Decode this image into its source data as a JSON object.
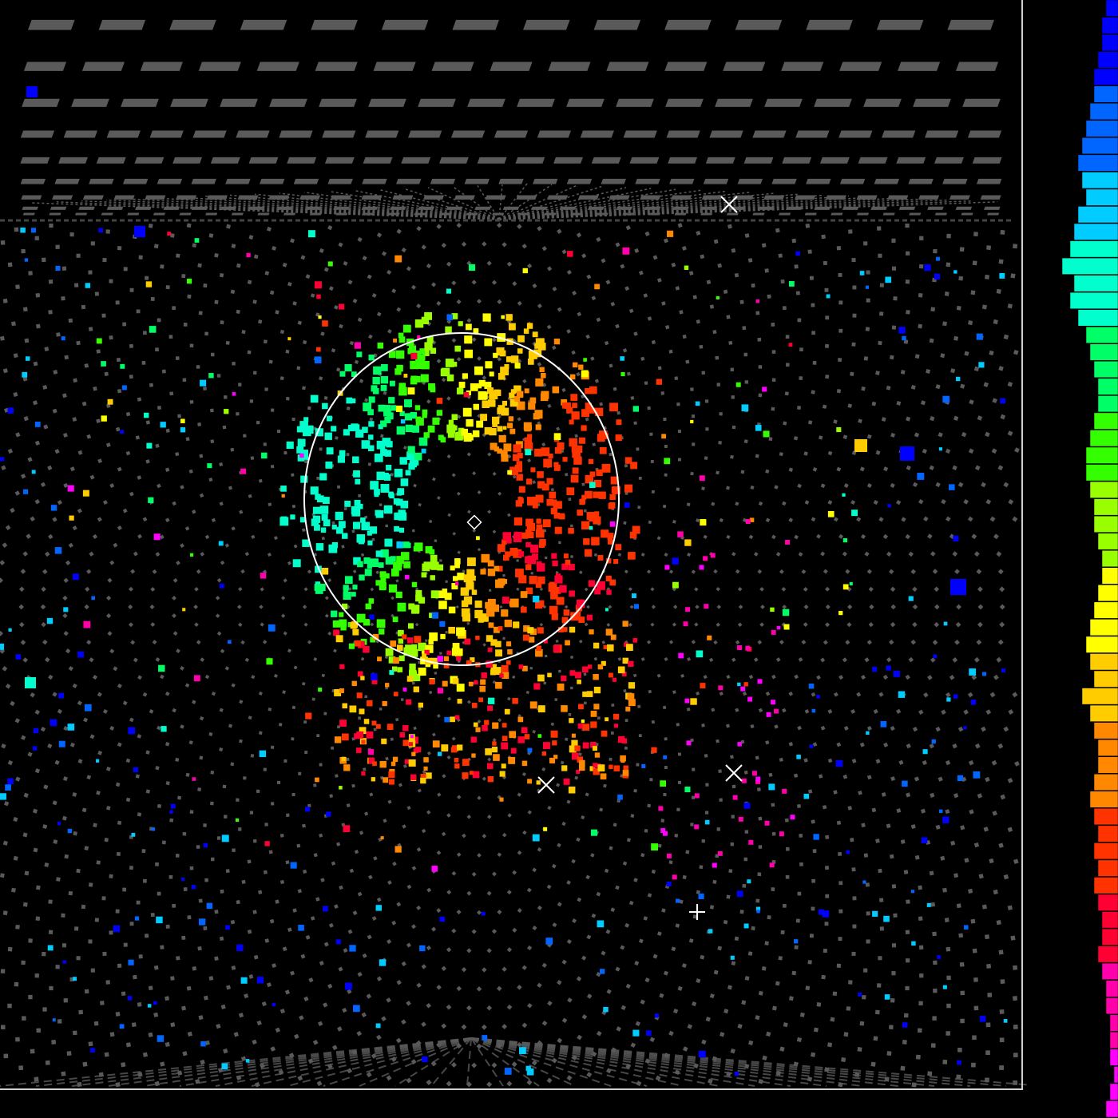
{
  "display": {
    "background": "#000000",
    "inactive_pmt_color": "#5a5a5a",
    "frame_color": "#d0d0d0",
    "ring_color": "#ffffff",
    "marker_color": "#ffffff"
  },
  "color_scale": [
    "#0000ff",
    "#0066ff",
    "#00ccff",
    "#00ffcc",
    "#00ff66",
    "#33ff00",
    "#99ff00",
    "#ffff00",
    "#ffcc00",
    "#ff8800",
    "#ff3300",
    "#ff0033",
    "#ff00aa",
    "#ff00ff"
  ],
  "fitted_vertex": {
    "marker": "diamond"
  },
  "markers": [
    {
      "name": "cross-marker",
      "glyph": "x"
    },
    {
      "name": "cross-marker",
      "glyph": "x"
    },
    {
      "name": "cross-marker",
      "glyph": "x"
    },
    {
      "name": "plus-marker",
      "glyph": "+"
    }
  ],
  "histogram": {
    "bar_values": [
      3,
      4,
      4,
      5,
      6,
      6,
      7,
      8,
      9,
      10,
      9,
      8,
      10,
      11,
      12,
      14,
      11,
      12,
      10,
      8,
      7,
      6,
      5,
      5,
      6,
      7,
      8,
      8,
      7,
      6,
      6,
      5,
      4,
      4,
      5,
      6,
      7,
      8,
      7,
      6,
      9,
      7,
      6,
      5,
      5,
      6,
      7,
      6,
      5,
      6,
      5,
      6,
      5,
      4,
      4,
      5,
      4,
      3,
      3,
      2,
      2,
      2,
      1,
      2,
      3
    ],
    "max_value": 14
  }
}
